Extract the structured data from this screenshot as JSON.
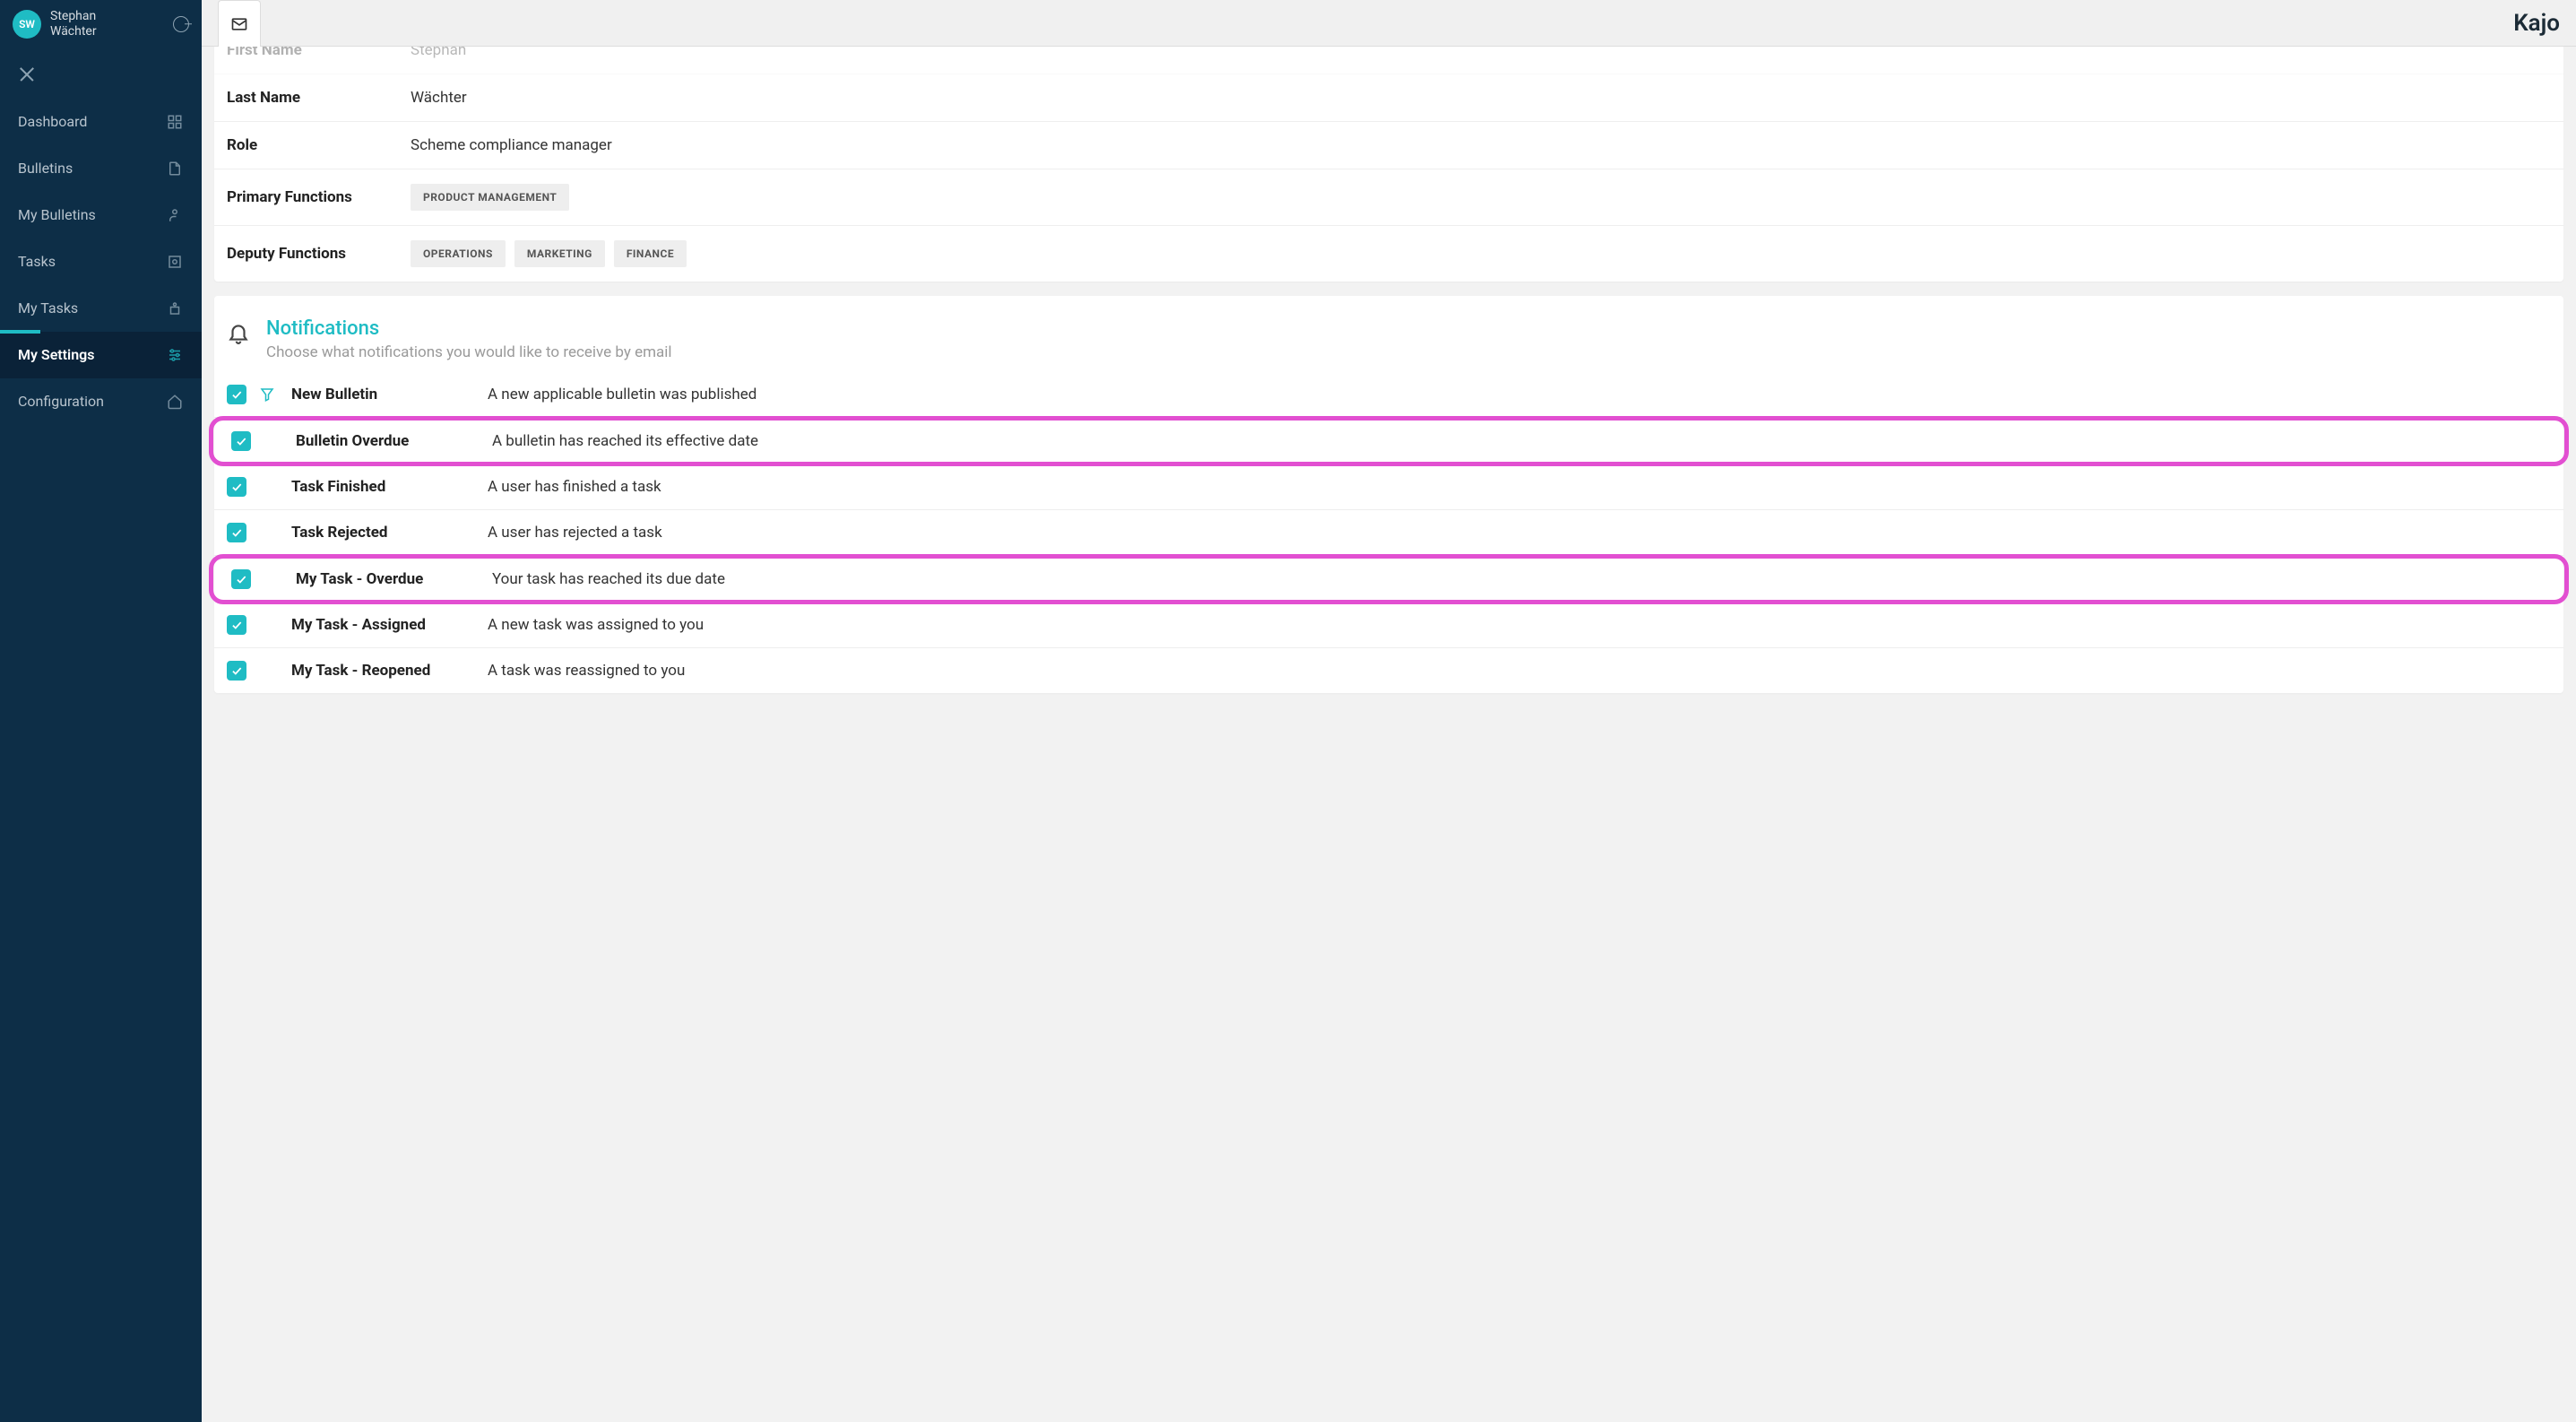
{
  "user": {
    "initials": "SW",
    "first_name_line": "Stephan",
    "last_name_line": "Wächter"
  },
  "sidebar": {
    "items": [
      {
        "label": "Dashboard",
        "active": false
      },
      {
        "label": "Bulletins",
        "active": false
      },
      {
        "label": "My Bulletins",
        "active": false
      },
      {
        "label": "Tasks",
        "active": false
      },
      {
        "label": "My Tasks",
        "active": false
      },
      {
        "label": "My Settings",
        "active": true
      },
      {
        "label": "Configuration",
        "active": false
      }
    ]
  },
  "brand": "Kajo",
  "profile": {
    "rows": {
      "first_name": {
        "label": "First Name",
        "value": "Stephan"
      },
      "last_name": {
        "label": "Last Name",
        "value": "Wächter"
      },
      "role": {
        "label": "Role",
        "value": "Scheme compliance manager"
      },
      "primary": {
        "label": "Primary Functions",
        "chips": [
          "PRODUCT MANAGEMENT"
        ]
      },
      "deputy": {
        "label": "Deputy Functions",
        "chips": [
          "OPERATIONS",
          "MARKETING",
          "FINANCE"
        ]
      }
    }
  },
  "notifications": {
    "title": "Notifications",
    "subtitle": "Choose what notifications you would like to receive by email",
    "items": [
      {
        "checked": true,
        "has_filter": true,
        "title": "New Bulletin",
        "desc": "A new applicable bulletin was published",
        "highlight": false
      },
      {
        "checked": true,
        "has_filter": false,
        "title": "Bulletin Overdue",
        "desc": "A bulletin has reached its effective date",
        "highlight": true
      },
      {
        "checked": true,
        "has_filter": false,
        "title": "Task Finished",
        "desc": "A user has finished a task",
        "highlight": false
      },
      {
        "checked": true,
        "has_filter": false,
        "title": "Task Rejected",
        "desc": "A user has rejected a task",
        "highlight": false
      },
      {
        "checked": true,
        "has_filter": false,
        "title": "My Task - Overdue",
        "desc": "Your task has reached its due date",
        "highlight": true
      },
      {
        "checked": true,
        "has_filter": false,
        "title": "My Task - Assigned",
        "desc": "A new task was assigned to you",
        "highlight": false
      },
      {
        "checked": true,
        "has_filter": false,
        "title": "My Task - Reopened",
        "desc": "A task was reassigned to you",
        "highlight": false
      }
    ]
  }
}
